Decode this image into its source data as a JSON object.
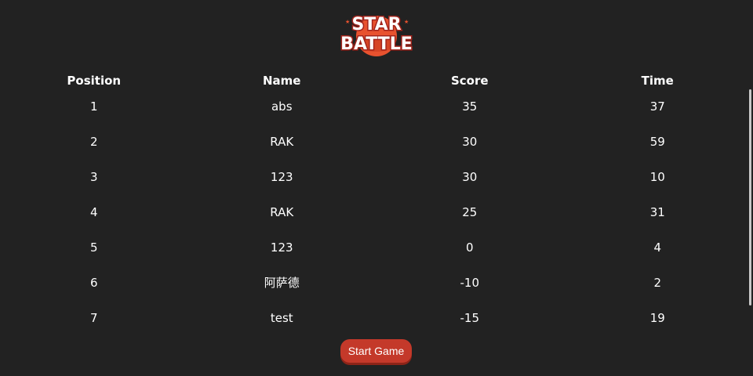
{
  "logo": {
    "line1": "STAR",
    "line2": "BATTLE",
    "colors": {
      "planet": "#e8522f",
      "text": "#ffffff",
      "outline": "#a2241c"
    }
  },
  "leaderboard": {
    "columns": [
      "Position",
      "Name",
      "Score",
      "Time"
    ],
    "rows": [
      {
        "position": "1",
        "name": "abs",
        "score": "35",
        "time": "37"
      },
      {
        "position": "2",
        "name": "RAK",
        "score": "30",
        "time": "59"
      },
      {
        "position": "3",
        "name": "123",
        "score": "30",
        "time": "10"
      },
      {
        "position": "4",
        "name": "RAK",
        "score": "25",
        "time": "31"
      },
      {
        "position": "5",
        "name": "123",
        "score": "0",
        "time": "4"
      },
      {
        "position": "6",
        "name": "阿萨德",
        "score": "-10",
        "time": "2"
      },
      {
        "position": "7",
        "name": "test",
        "score": "-15",
        "time": "19"
      }
    ]
  },
  "start_button": {
    "label": "Start Game",
    "color": "#c4392a"
  },
  "theme": {
    "background": "#222222",
    "text": "#ffffff"
  }
}
